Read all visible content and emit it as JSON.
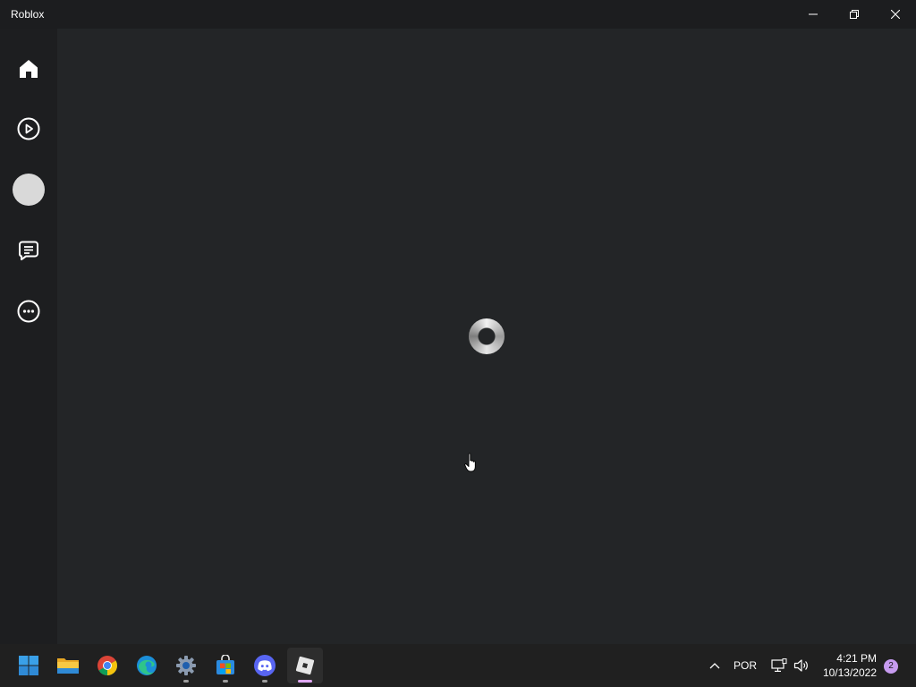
{
  "window": {
    "title": "Roblox",
    "controls": {
      "minimize": "minimize-icon",
      "maximize": "restore-icon",
      "close": "close-icon"
    }
  },
  "sidebar": {
    "items": [
      {
        "id": "home",
        "icon": "home-icon"
      },
      {
        "id": "play",
        "icon": "play-circle-icon"
      },
      {
        "id": "avatar",
        "icon": "avatar-icon"
      },
      {
        "id": "chat",
        "icon": "chat-icon"
      },
      {
        "id": "more",
        "icon": "more-icon"
      }
    ]
  },
  "main": {
    "state": "loading",
    "spinner_icon": "loading-spinner-icon"
  },
  "taskbar": {
    "apps": [
      {
        "id": "start",
        "icon": "windows-start-icon",
        "running": false
      },
      {
        "id": "file-explorer",
        "icon": "folder-icon",
        "running": false
      },
      {
        "id": "chrome",
        "icon": "chrome-icon",
        "running": false
      },
      {
        "id": "edge",
        "icon": "edge-icon",
        "running": false
      },
      {
        "id": "settings",
        "icon": "gear-icon",
        "running": true
      },
      {
        "id": "store",
        "icon": "store-icon",
        "running": true
      },
      {
        "id": "discord",
        "icon": "discord-icon",
        "running": true
      },
      {
        "id": "roblox",
        "icon": "roblox-icon",
        "running": true,
        "active": true
      }
    ],
    "tray": {
      "overflow_icon": "chevron-up-icon",
      "language": "POR",
      "network_icon": "network-icon",
      "volume_icon": "volume-icon",
      "time": "4:21 PM",
      "date": "10/13/2022",
      "notification_count": "2"
    }
  },
  "colors": {
    "background": "#232527",
    "sidebar": "#1d1e20",
    "titlebar": "#1c1d1f",
    "taskbar": "#202020",
    "active_indicator": "#e0a8f4",
    "notification_badge": "#c79bf0"
  }
}
